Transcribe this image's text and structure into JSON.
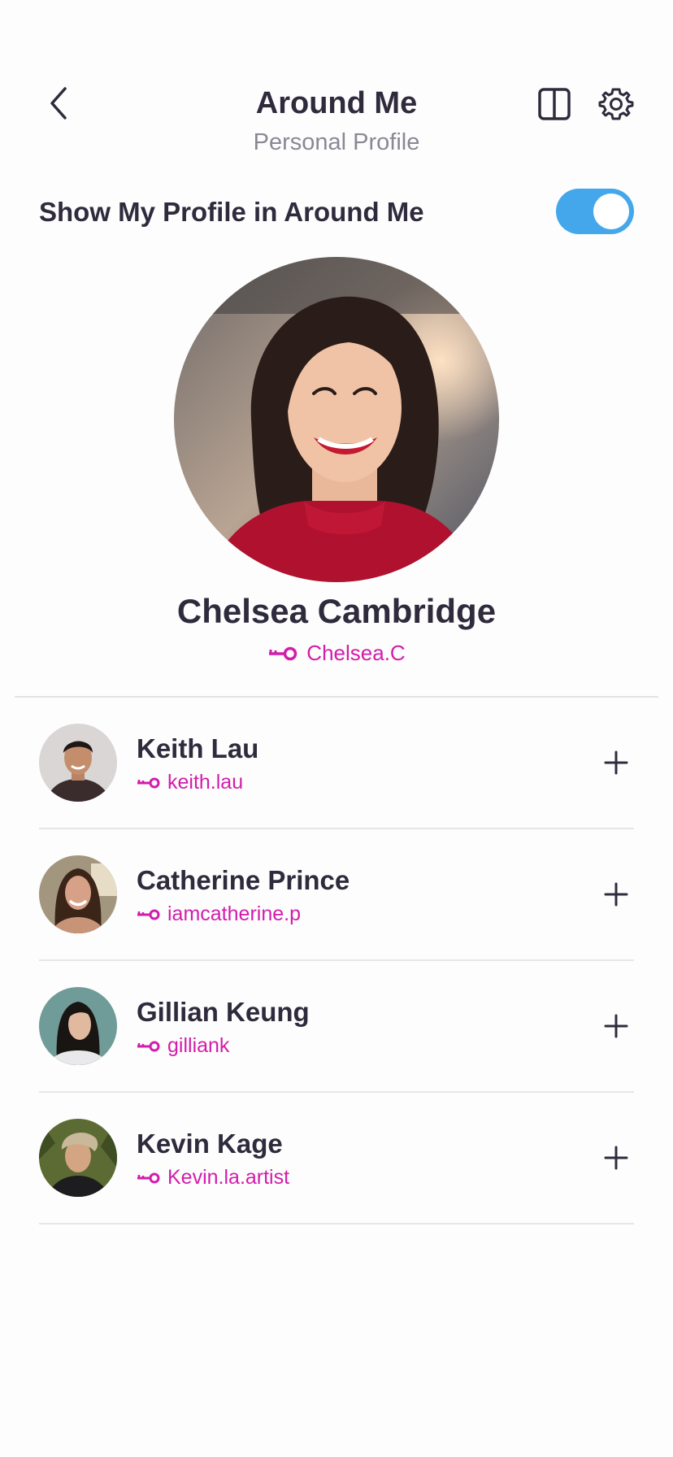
{
  "header": {
    "title": "Around Me",
    "subtitle": "Personal Profile"
  },
  "icons": {
    "back": "chevron-left-icon",
    "layout": "split-view-icon",
    "settings": "gear-icon",
    "handle": "key-icon",
    "add": "plus-icon"
  },
  "toggle": {
    "label": "Show My Profile in Around Me",
    "on": true
  },
  "profile": {
    "name": "Chelsea Cambridge",
    "handle": "Chelsea.C"
  },
  "people": [
    {
      "name": "Keith Lau",
      "handle": "keith.lau"
    },
    {
      "name": "Catherine Prince",
      "handle": "iamcatherine.p"
    },
    {
      "name": "Gillian Keung",
      "handle": "gilliank"
    },
    {
      "name": "Kevin Kage",
      "handle": "Kevin.la.artist"
    }
  ],
  "colors": {
    "accent": "#d21dac",
    "toggle": "#45a7eb",
    "text": "#2f2b3d",
    "muted": "#8a8894"
  }
}
